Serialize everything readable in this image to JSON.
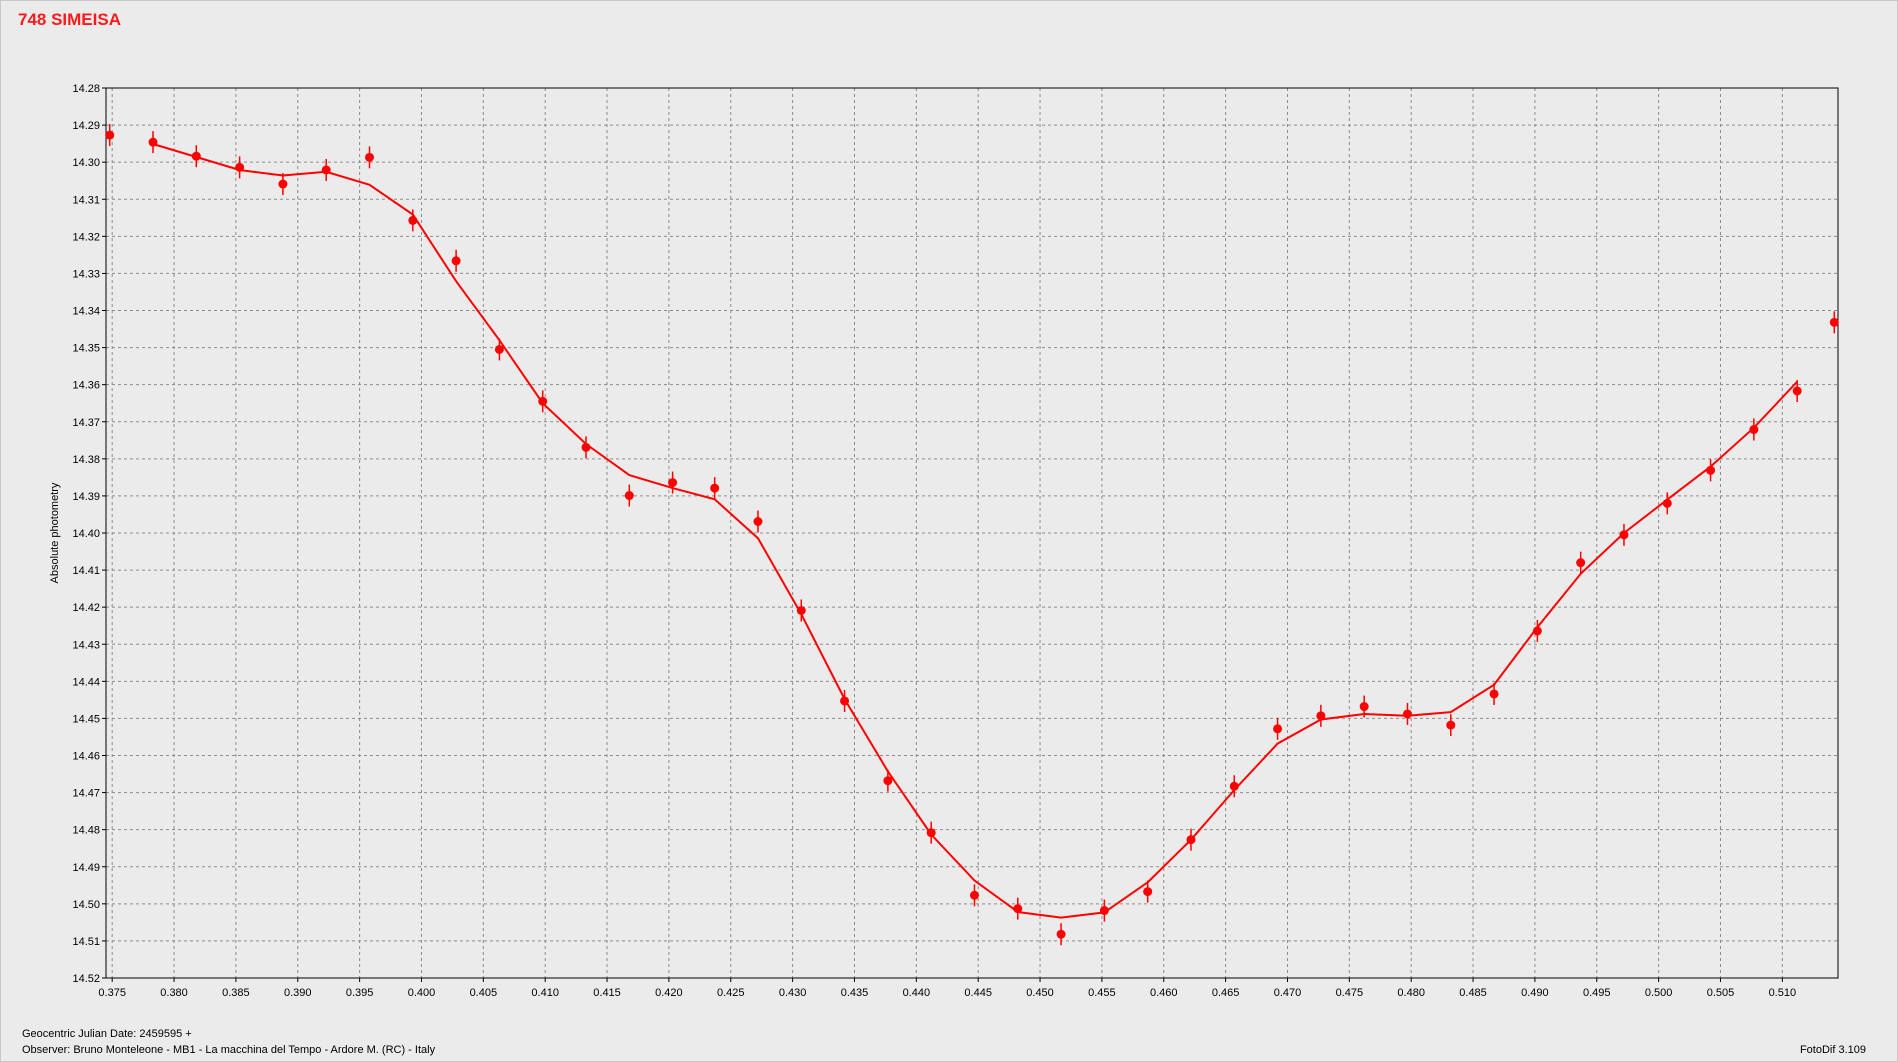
{
  "title": "748 SIMEISA",
  "footer": {
    "julian_date": "Geocentric Julian Date: 2459595 +",
    "observer": "Observer: Bruno Monteleone - MB1 - La macchina del Tempo - Ardore M. (RC) - Italy",
    "software": "FotoDif 3.109"
  },
  "colors": {
    "series": "#ff0000",
    "background": "#ebebeb",
    "grid": "#888888"
  },
  "chart_data": {
    "type": "scatter",
    "title": "748 SIMEISA",
    "ylabel": "Absolute photometry",
    "xlabel": "",
    "xlim": [
      0.3745,
      0.5145
    ],
    "ylim": [
      14.28,
      14.52
    ],
    "y_inverted": true,
    "grid": true,
    "xticks": [
      "0.375",
      "0.380",
      "0.385",
      "0.390",
      "0.395",
      "0.400",
      "0.405",
      "0.410",
      "0.415",
      "0.420",
      "0.425",
      "0.430",
      "0.435",
      "0.440",
      "0.445",
      "0.450",
      "0.455",
      "0.460",
      "0.465",
      "0.470",
      "0.475",
      "0.480",
      "0.485",
      "0.490",
      "0.495",
      "0.500",
      "0.505",
      "0.510"
    ],
    "yticks": [
      "14.28",
      "14.29",
      "14.30",
      "14.31",
      "14.32",
      "14.33",
      "14.34",
      "14.35",
      "14.36",
      "14.37",
      "14.38",
      "14.39",
      "14.40",
      "14.41",
      "14.42",
      "14.43",
      "14.44",
      "14.45",
      "14.46",
      "14.47",
      "14.48",
      "14.49",
      "14.50",
      "14.51",
      "14.52"
    ],
    "points": [
      {
        "x": 0.3748,
        "y": 14.2927
      },
      {
        "x": 0.3783,
        "y": 14.2946
      },
      {
        "x": 0.3818,
        "y": 14.2984
      },
      {
        "x": 0.3853,
        "y": 14.3014
      },
      {
        "x": 0.3888,
        "y": 14.3059
      },
      {
        "x": 0.3923,
        "y": 14.3021
      },
      {
        "x": 0.3958,
        "y": 14.2987
      },
      {
        "x": 0.3993,
        "y": 14.3157
      },
      {
        "x": 0.4028,
        "y": 14.3266
      },
      {
        "x": 0.4063,
        "y": 14.3505
      },
      {
        "x": 0.4098,
        "y": 14.3645
      },
      {
        "x": 0.4133,
        "y": 14.3769
      },
      {
        "x": 0.4168,
        "y": 14.3899
      },
      {
        "x": 0.4203,
        "y": 14.3864
      },
      {
        "x": 0.4237,
        "y": 14.3879
      },
      {
        "x": 0.4272,
        "y": 14.3969
      },
      {
        "x": 0.4307,
        "y": 14.4209
      },
      {
        "x": 0.4342,
        "y": 14.4453
      },
      {
        "x": 0.4377,
        "y": 14.4668
      },
      {
        "x": 0.4412,
        "y": 14.4808
      },
      {
        "x": 0.4447,
        "y": 14.4977
      },
      {
        "x": 0.4482,
        "y": 14.5013
      },
      {
        "x": 0.4517,
        "y": 14.5082
      },
      {
        "x": 0.4552,
        "y": 14.5018
      },
      {
        "x": 0.4587,
        "y": 14.4967
      },
      {
        "x": 0.4622,
        "y": 14.4827
      },
      {
        "x": 0.4657,
        "y": 14.4683
      },
      {
        "x": 0.4692,
        "y": 14.4528
      },
      {
        "x": 0.4727,
        "y": 14.4493
      },
      {
        "x": 0.4762,
        "y": 14.4468
      },
      {
        "x": 0.4797,
        "y": 14.4488
      },
      {
        "x": 0.4832,
        "y": 14.4518
      },
      {
        "x": 0.4867,
        "y": 14.4434
      },
      {
        "x": 0.4902,
        "y": 14.4264
      },
      {
        "x": 0.4937,
        "y": 14.408
      },
      {
        "x": 0.4972,
        "y": 14.4005
      },
      {
        "x": 0.5007,
        "y": 14.392
      },
      {
        "x": 0.5042,
        "y": 14.3831
      },
      {
        "x": 0.5077,
        "y": 14.3721
      },
      {
        "x": 0.5112,
        "y": 14.3617
      },
      {
        "x": 0.5142,
        "y": 14.3432
      }
    ],
    "fit_curve": [
      {
        "x": 0.3783,
        "y": 14.2951
      },
      {
        "x": 0.3818,
        "y": 14.2986
      },
      {
        "x": 0.3853,
        "y": 14.3021
      },
      {
        "x": 0.3888,
        "y": 14.3036
      },
      {
        "x": 0.3923,
        "y": 14.3026
      },
      {
        "x": 0.3958,
        "y": 14.3061
      },
      {
        "x": 0.3993,
        "y": 14.3141
      },
      {
        "x": 0.4028,
        "y": 14.3321
      },
      {
        "x": 0.4063,
        "y": 14.348
      },
      {
        "x": 0.4098,
        "y": 14.365
      },
      {
        "x": 0.4133,
        "y": 14.376
      },
      {
        "x": 0.4168,
        "y": 14.3844
      },
      {
        "x": 0.4203,
        "y": 14.3879
      },
      {
        "x": 0.4237,
        "y": 14.3909
      },
      {
        "x": 0.4272,
        "y": 14.4014
      },
      {
        "x": 0.4307,
        "y": 14.4219
      },
      {
        "x": 0.4342,
        "y": 14.4448
      },
      {
        "x": 0.4377,
        "y": 14.4643
      },
      {
        "x": 0.4412,
        "y": 14.4813
      },
      {
        "x": 0.4447,
        "y": 14.4937
      },
      {
        "x": 0.4482,
        "y": 14.5022
      },
      {
        "x": 0.4517,
        "y": 14.5037
      },
      {
        "x": 0.4552,
        "y": 14.5023
      },
      {
        "x": 0.4587,
        "y": 14.4942
      },
      {
        "x": 0.4622,
        "y": 14.4827
      },
      {
        "x": 0.4657,
        "y": 14.4693
      },
      {
        "x": 0.4692,
        "y": 14.4568
      },
      {
        "x": 0.4727,
        "y": 14.4503
      },
      {
        "x": 0.4762,
        "y": 14.4488
      },
      {
        "x": 0.4797,
        "y": 14.4493
      },
      {
        "x": 0.4832,
        "y": 14.4483
      },
      {
        "x": 0.4867,
        "y": 14.4409
      },
      {
        "x": 0.4902,
        "y": 14.4254
      },
      {
        "x": 0.4937,
        "y": 14.411
      },
      {
        "x": 0.4972,
        "y": 14.4
      },
      {
        "x": 0.5007,
        "y": 14.391
      },
      {
        "x": 0.5042,
        "y": 14.3821
      },
      {
        "x": 0.5077,
        "y": 14.3716
      },
      {
        "x": 0.5112,
        "y": 14.3592
      }
    ]
  }
}
